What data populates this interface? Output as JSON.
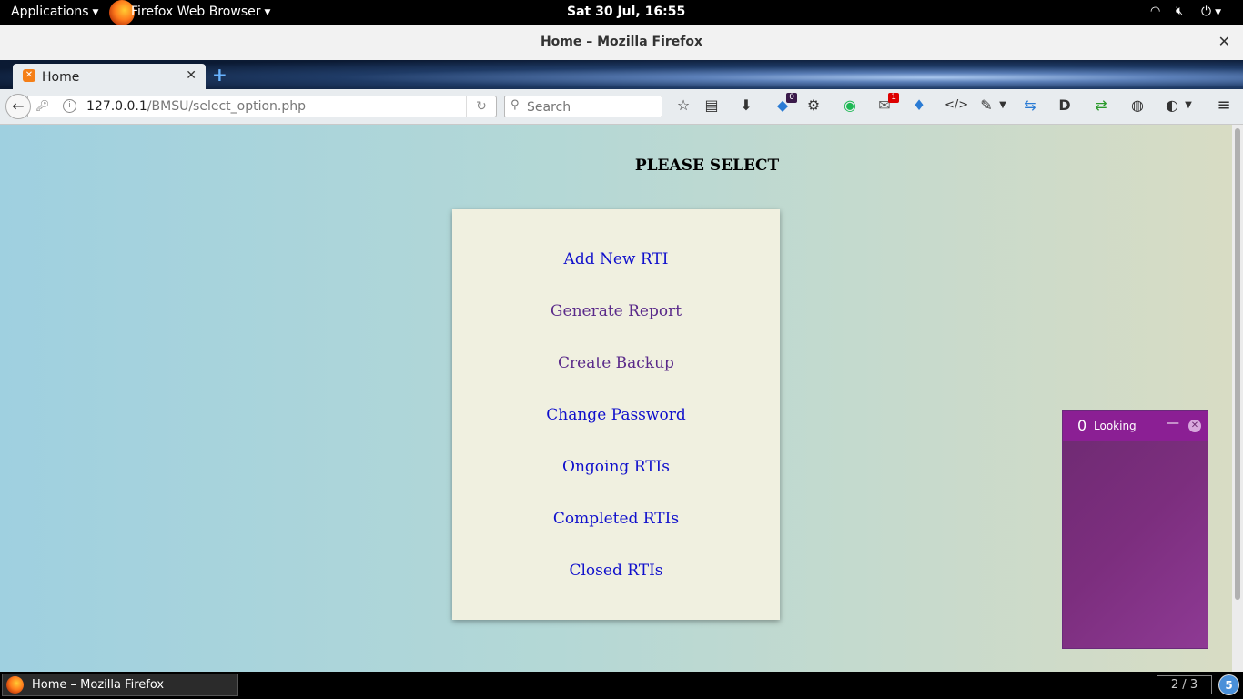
{
  "topbar": {
    "applications": "Applications",
    "app_name": "Firefox Web Browser",
    "datetime": "Sat 30 Jul, 16:55"
  },
  "window": {
    "title": "Home – Mozilla Firefox"
  },
  "tab": {
    "label": "Home"
  },
  "navbar": {
    "url_host": "127.0.0.1",
    "url_path": "/BMSU/select_option.php",
    "search_placeholder": "Search",
    "badges": {
      "extension_1": "0",
      "mail": "1"
    }
  },
  "page": {
    "heading": "PLEASE SELECT",
    "links": [
      {
        "label": "Add New RTI"
      },
      {
        "label": "Generate Report"
      },
      {
        "label": "Create Backup"
      },
      {
        "label": "Change Password"
      },
      {
        "label": "Ongoing RTIs"
      },
      {
        "label": "Completed RTIs"
      },
      {
        "label": "Closed RTIs"
      }
    ]
  },
  "widget": {
    "count": "0",
    "label": "Looking"
  },
  "taskbar": {
    "task_label": "Home – Mozilla Firefox",
    "workspace": "2 / 3",
    "notification_count": "5"
  },
  "colors": {
    "link": "#1010cc",
    "visited_link": "#5a2a8a",
    "card_bg": "#f0f0e0",
    "widget_accent": "#8b1f94"
  }
}
